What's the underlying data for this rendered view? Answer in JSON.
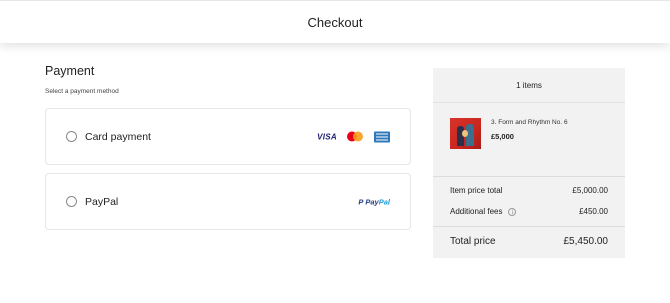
{
  "header": {
    "title": "Checkout"
  },
  "payment": {
    "heading": "Payment",
    "subheading": "Select a payment method",
    "methods": [
      {
        "label": "Card payment",
        "selected": false,
        "logos": [
          "VISA",
          "mastercard",
          "amex"
        ]
      },
      {
        "label": "PayPal",
        "selected": false,
        "logos": [
          "PayPal"
        ]
      }
    ]
  },
  "logos": {
    "visa": "VISA",
    "paypal_mark": "P",
    "paypal_1": "Pay",
    "paypal_2": "Pal"
  },
  "summary": {
    "count": "1 items",
    "item": {
      "name": "3. Form and Rhythm No. 6",
      "price": "£5,000"
    },
    "item_price_total_label": "Item price total",
    "item_price_total_value": "£5,000.00",
    "additional_fees_label": "Additional fees",
    "additional_fees_value": "£450.00",
    "total_label": "Total price",
    "total_value": "£5,450.00"
  },
  "colors": {
    "summary_bg": "#f2f2f2",
    "visa": "#1a1f71",
    "paypal_dark": "#253b80",
    "paypal_light": "#179bd7"
  }
}
